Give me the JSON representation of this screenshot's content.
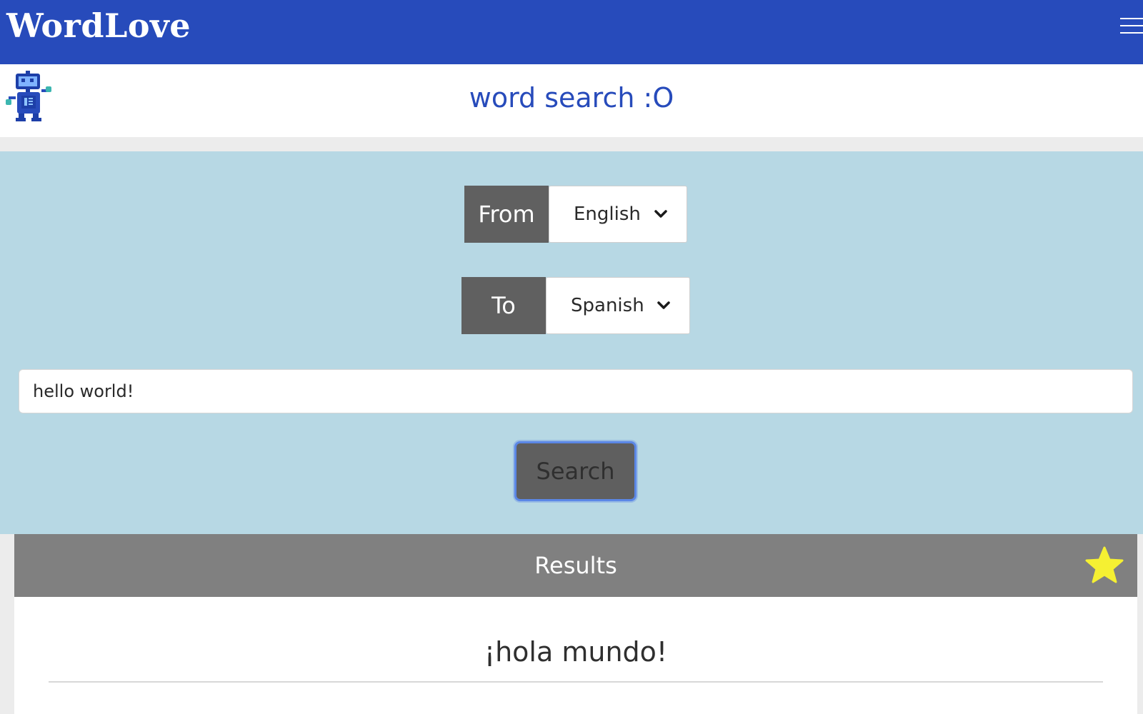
{
  "app": {
    "brand": "WordLove",
    "menu_icon": "hamburger-menu-icon",
    "mascot_icon": "robot-icon"
  },
  "header": {
    "title": "word search :O"
  },
  "form": {
    "from_label": "From",
    "from_value": "English",
    "to_label": "To",
    "to_value": "Spanish",
    "query_value": "hello world!",
    "search_label": "Search"
  },
  "results": {
    "title": "Results",
    "favorite_icon": "star-icon",
    "items": [
      "¡hola mundo!"
    ]
  },
  "colors": {
    "brand_blue": "#274bbb",
    "panel_bg": "#b7d8e4",
    "label_dark": "#606060",
    "results_header": "#808080",
    "star_yellow": "#f5f032",
    "focus_ring": "#5b87e6"
  }
}
